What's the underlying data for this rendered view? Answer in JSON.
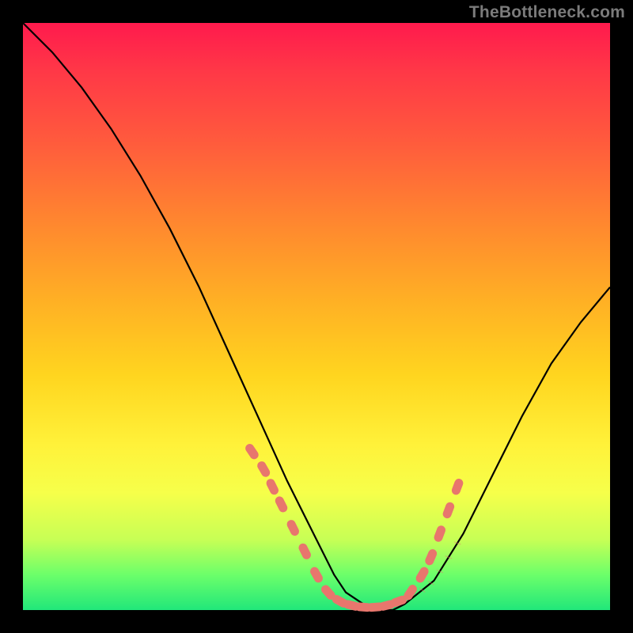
{
  "watermark": "TheBottleneck.com",
  "colors": {
    "background": "#000000",
    "gradient_top": "#ff1a4d",
    "gradient_mid": "#ffd51f",
    "gradient_bottom": "#21e77a",
    "curve": "#000000",
    "markers": "#e8766d"
  },
  "chart_data": {
    "type": "line",
    "title": "",
    "xlabel": "",
    "ylabel": "",
    "xlim": [
      0,
      100
    ],
    "ylim": [
      0,
      100
    ],
    "grid": false,
    "series": [
      {
        "name": "bottleneck-curve",
        "x": [
          0,
          5,
          10,
          15,
          20,
          25,
          30,
          35,
          40,
          45,
          50,
          53,
          55,
          58,
          60,
          63,
          65,
          70,
          75,
          80,
          85,
          90,
          95,
          100
        ],
        "y": [
          100,
          95,
          89,
          82,
          74,
          65,
          55,
          44,
          33,
          22,
          12,
          6,
          3,
          1,
          0,
          0,
          1,
          5,
          13,
          23,
          33,
          42,
          49,
          55
        ]
      }
    ],
    "markers": [
      {
        "name": "left-foot-cluster",
        "shape": "pill",
        "points": [
          {
            "x": 39,
            "y": 27
          },
          {
            "x": 41,
            "y": 24
          },
          {
            "x": 42.5,
            "y": 21
          },
          {
            "x": 44,
            "y": 18
          },
          {
            "x": 46,
            "y": 14
          },
          {
            "x": 48,
            "y": 10
          },
          {
            "x": 50,
            "y": 6
          },
          {
            "x": 52,
            "y": 3
          },
          {
            "x": 54,
            "y": 1.5
          },
          {
            "x": 56,
            "y": 0.8
          },
          {
            "x": 58,
            "y": 0.5
          },
          {
            "x": 60,
            "y": 0.5
          },
          {
            "x": 62,
            "y": 0.8
          },
          {
            "x": 64,
            "y": 1.5
          }
        ]
      },
      {
        "name": "right-foot-cluster",
        "shape": "pill",
        "points": [
          {
            "x": 66,
            "y": 3
          },
          {
            "x": 68,
            "y": 6
          },
          {
            "x": 69.5,
            "y": 9
          },
          {
            "x": 71,
            "y": 13
          },
          {
            "x": 72.5,
            "y": 17
          },
          {
            "x": 74,
            "y": 21
          }
        ]
      }
    ],
    "annotations": []
  }
}
